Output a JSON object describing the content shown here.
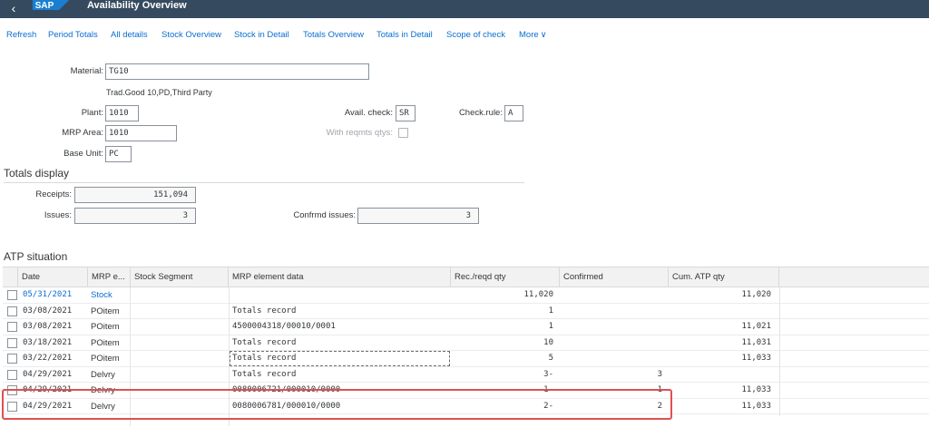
{
  "shell": {
    "back_icon": "back-arrow-icon",
    "logo": "SAP",
    "title": "Availability Overview"
  },
  "toolbar": {
    "items": [
      "Refresh",
      "Period Totals",
      "All details",
      "Stock Overview",
      "Stock in Detail",
      "Totals Overview",
      "Totals in Detail",
      "Scope of check",
      "More"
    ]
  },
  "header": {
    "material_label": "Material:",
    "material_value": "TG10",
    "material_desc": "Trad.Good 10,PD,Third Party",
    "plant_label": "Plant:",
    "plant_value": "1010",
    "mrp_area_label": "MRP Area:",
    "mrp_area_value": "1010",
    "base_unit_label": "Base Unit:",
    "base_unit_value": "PC",
    "avail_check_label": "Avail. check:",
    "avail_check_value": "SR",
    "check_rule_label": "Check.rule:",
    "check_rule_value": "A",
    "with_reqmts_label": "With reqmts qtys:"
  },
  "totals": {
    "title": "Totals display",
    "receipts_label": "Receipts:",
    "receipts_value": "151,094",
    "issues_label": "Issues:",
    "issues_value": "3",
    "confirmed_label": "Confrmd issues:",
    "confirmed_value": "3"
  },
  "atp": {
    "title": "ATP situation",
    "columns": [
      "Date",
      "MRP e...",
      "Stock Segment",
      "MRP element data",
      "Rec./reqd qty",
      "Confirmed",
      "Cum. ATP qty"
    ],
    "rows": [
      {
        "date": "05/31/2021",
        "mrp": "Stock",
        "segment": "",
        "data": "",
        "qty": "11,020",
        "confirmed": "",
        "cum": "11,020",
        "link": true
      },
      {
        "date": "03/08/2021",
        "mrp": "POitem",
        "segment": "",
        "data": "Totals record",
        "qty": "1",
        "confirmed": "",
        "cum": ""
      },
      {
        "date": "03/08/2021",
        "mrp": "POitem",
        "segment": "",
        "data": "4500004318/00010/0001",
        "qty": "1",
        "confirmed": "",
        "cum": "11,021"
      },
      {
        "date": "03/18/2021",
        "mrp": "POitem",
        "segment": "",
        "data": "Totals record",
        "qty": "10",
        "confirmed": "",
        "cum": "11,031"
      },
      {
        "date": "03/22/2021",
        "mrp": "POitem",
        "segment": "",
        "data": "Totals record",
        "qty": "5",
        "confirmed": "",
        "cum": "11,033"
      },
      {
        "date": "04/29/2021",
        "mrp": "Delvry",
        "segment": "",
        "data": "Totals record",
        "qty": "3-",
        "confirmed": "3",
        "cum": ""
      },
      {
        "date": "04/29/2021",
        "mrp": "Delvry",
        "segment": "",
        "data": "0080006721/000010/0000",
        "qty": "1-",
        "confirmed": "1",
        "cum": "11,033"
      },
      {
        "date": "04/29/2021",
        "mrp": "Delvry",
        "segment": "",
        "data": "0080006781/000010/0000",
        "qty": "2-",
        "confirmed": "2",
        "cum": "11,033"
      }
    ]
  },
  "colors": {
    "shell_bg": "#354a5f",
    "link": "#0a6ed1",
    "highlight": "#e05050"
  }
}
